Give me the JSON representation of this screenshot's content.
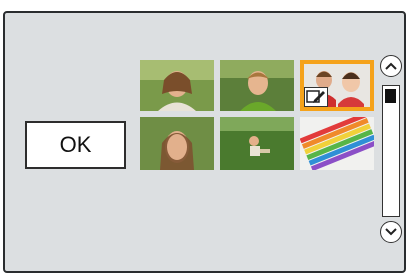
{
  "dialog": {
    "ok_label": "OK"
  },
  "thumbnails": [
    {
      "name": "woman-portrait",
      "selected": false
    },
    {
      "name": "boy-portrait",
      "selected": false
    },
    {
      "name": "children-portrait",
      "selected": true,
      "badge": "edit-icon"
    },
    {
      "name": "woman-closeup",
      "selected": false
    },
    {
      "name": "child-on-grass",
      "selected": false
    },
    {
      "name": "colored-pencils",
      "selected": false
    }
  ],
  "scrollbar": {
    "up_icon": "chevron-up-icon",
    "down_icon": "chevron-down-icon",
    "position": 0.0
  },
  "colors": {
    "selection": "#f5a21a",
    "background": "#dcdfe1"
  }
}
